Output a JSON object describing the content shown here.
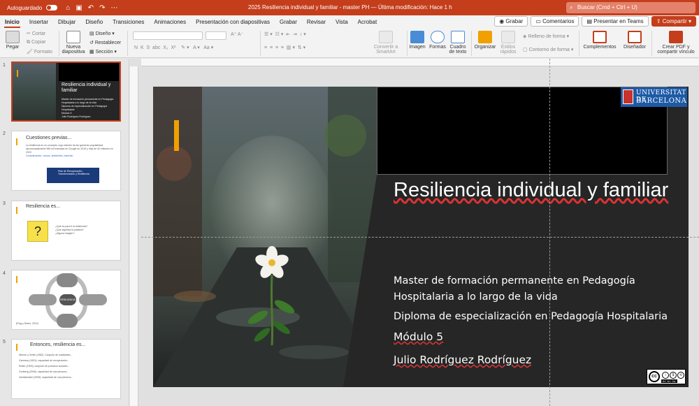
{
  "titlebar": {
    "autosave_label": "Autoguardado",
    "doc_title": "2025 Resiliencia individual y familiar - master PH — Última modificación: Hace 1 h",
    "search_placeholder": "Buscar (Cmd + Ctrl + U)"
  },
  "tabs": [
    "Inicio",
    "Insertar",
    "Dibujar",
    "Diseño",
    "Transiciones",
    "Animaciones",
    "Presentación con diapositivas",
    "Grabar",
    "Revisar",
    "Vista",
    "Acrobat"
  ],
  "tab_actions": {
    "record": "Grabar",
    "comments": "Comentarios",
    "teams": "Presentar en Teams",
    "share": "Compartir"
  },
  "ribbon": {
    "paste": "Pegar",
    "cut": "Cortar",
    "copy": "Copiar",
    "format": "Formato",
    "new_slide": "Nueva diapositiva",
    "design": "Diseño",
    "reset": "Restablecer",
    "section": "Sección",
    "convert": "Convertir a SmartArt",
    "image": "Imagen",
    "shapes": "Formas",
    "textbox": "Cuadro de texto",
    "arrange": "Organizar",
    "quick_styles": "Estilos rápidos",
    "fill": "Relleno de forma",
    "outline": "Contorno de forma",
    "addins": "Complementos",
    "designer": "Diseñador",
    "pdf": "Crear PDF y compartir vínculo"
  },
  "thumbnails": [
    {
      "num": "1",
      "title": "Resiliencia individual y familiar",
      "lines": [
        "Master de formación permanente en Pedagogía Hospitalaria a lo largo de la vida",
        "Diploma de especialización en Pedagogía Hospitalaria",
        "Módulo 5",
        "Julio Rodríguez Rodríguez"
      ]
    },
    {
      "num": "2",
      "title": "Cuestiones previas...",
      "lines": [
        "La resiliencia es un concepto cuyo estudio ha ido ganando popularidad. Aproximadamente 983 mil entradas en Google en 2015 y más de 40 millones en 2023",
        "Consideración, cursos, ambientes, intuición",
        "Plan de Recuperación, Transformación y Resiliencia"
      ]
    },
    {
      "num": "3",
      "title": "Resiliencia es...",
      "lines": [
        "¿Qué es para ti la resiliencia?",
        "¿Qué significa la palabra?",
        "¿Alguna imagen?"
      ]
    },
    {
      "num": "4",
      "title": "",
      "lines": [
        "RESILIENCIA",
        "(Puig y Rubio, 2013)"
      ]
    },
    {
      "num": "5",
      "title": "Entonces, resiliencia es...",
      "lines": [
        "Werner y Smith (1982): Conjunto de cualidades...",
        "Garmezy (1991): capacidad de recuperación...",
        "Rutter (1993): conjunto de procesos sociales...",
        "Grotberg (2006): capacidad de una persona...",
        "Vanistendael (2005): capacidad de una persona..."
      ]
    }
  ],
  "slide": {
    "title": "Resiliencia individual y familiar",
    "line1": "Master de formación permanente en Pedagogía",
    "line2": "Hospitalaria a lo largo de la vida",
    "line3": "Diploma de especialización en Pedagogía Hospitalaria",
    "line4": "Módulo 5",
    "line5": "Julio Rodríguez Rodríguez",
    "logo_l1": "UNIVERSITAT DE",
    "logo_l2": "BARCELONA",
    "cc_label": "BY NC SA"
  }
}
